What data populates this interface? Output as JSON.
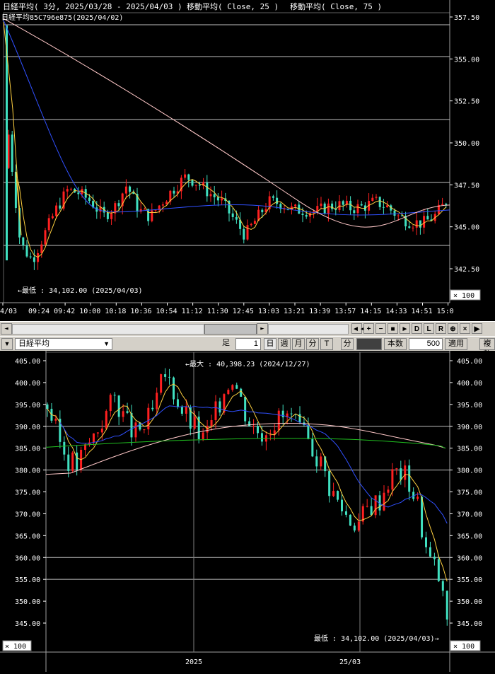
{
  "top_chart": {
    "legend_main": "日経平均( 3分, 2025/03/28 - 2025/04/03 )",
    "legend_ma25": "移動平均( Close, 25 )",
    "legend_ma75": "移動平均( Close, 75 )",
    "overlay_text": "日経平均85C796e875(2025/04/02)",
    "low_label": "←最低 : 34,102.00 (2025/04/03)",
    "scale_box": "× 100",
    "y_ticks": [
      "357.50",
      "355.00",
      "352.50",
      "350.00",
      "347.50",
      "345.00",
      "342.50"
    ],
    "x_ticks": [
      "4/03",
      "09:24",
      "09:42",
      "10:00",
      "10:18",
      "10:36",
      "10:54",
      "11:12",
      "11:30",
      "12:45",
      "13:03",
      "13:21",
      "13:39",
      "13:57",
      "14:15",
      "14:33",
      "14:51",
      "15:0"
    ]
  },
  "scrollbar": {
    "left_arrow": "◄",
    "right_arrow": "►",
    "buttons": [
      "◄◄",
      "+",
      "−",
      "■",
      "►",
      "D",
      "L",
      "R",
      "⊕",
      "×",
      "▶"
    ]
  },
  "toolbar": {
    "dropdown_arrow": "▼",
    "instrument": "日経平均",
    "select_arrow": "▼",
    "ashi_label": "足",
    "ashi_value": "1",
    "unit_buttons": [
      "日",
      "週",
      "月",
      "分",
      "T"
    ],
    "fun_label": "分",
    "count_label": "本数",
    "count_value": "500",
    "apply_label": "適用",
    "multi_label": "複数"
  },
  "bottom_chart": {
    "high_label": "←最大 : 40,398.23 (2024/12/27)",
    "low_label": "最低 : 34,102.00 (2025/04/03)→",
    "scale_box": "× 100",
    "y_ticks": [
      "405.00",
      "400.00",
      "395.00",
      "390.00",
      "385.00",
      "380.00",
      "375.00",
      "370.00",
      "365.00",
      "360.00",
      "355.00",
      "350.00",
      "345.00"
    ],
    "x_ticks": [
      "2025",
      "25/03"
    ]
  },
  "colors": {
    "background": "#000000",
    "up_candle": "#ff2020",
    "down_candle": "#40e0c0",
    "ma_short": "#ffd040",
    "ma_mid": "#3050ff",
    "ma_long": "#ffc8c8",
    "ma_green": "#20c020",
    "grid": "#ffffff"
  }
}
